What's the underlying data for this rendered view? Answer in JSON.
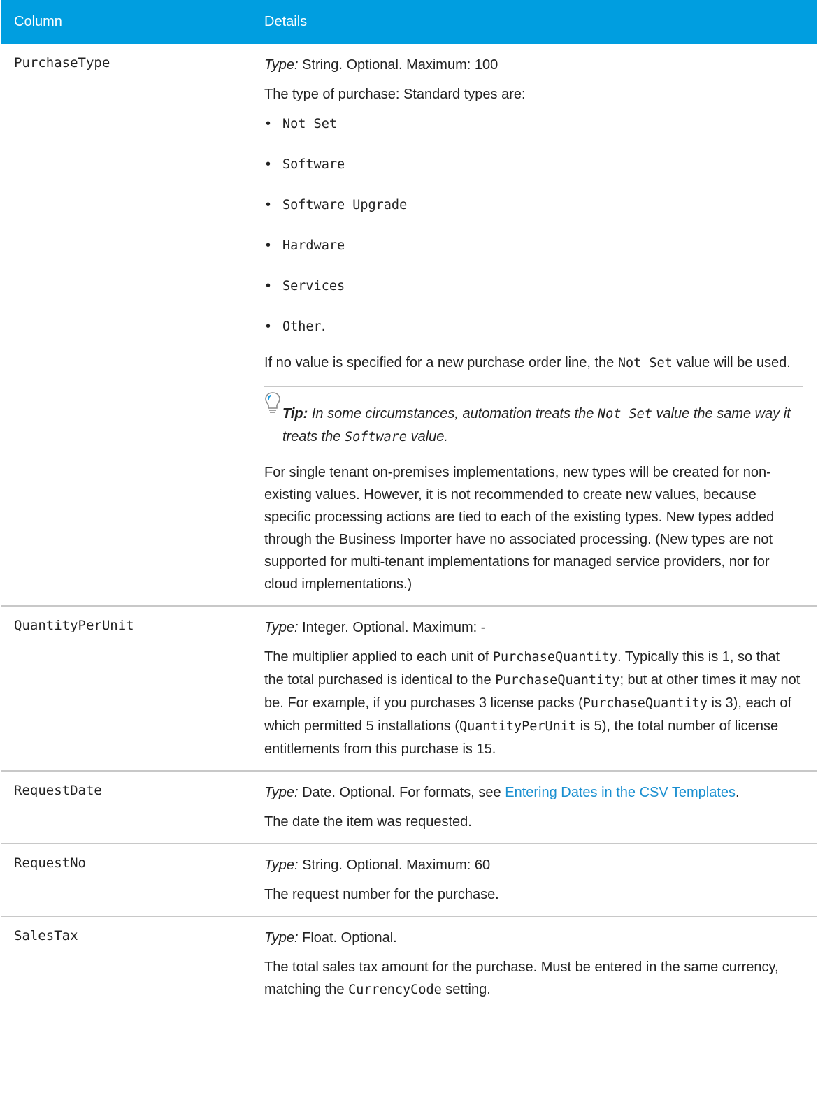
{
  "header": {
    "col1": "Column",
    "col2": "Details"
  },
  "type_label": "Type:",
  "rows": [
    {
      "name": "PurchaseType",
      "type_text": "String. Optional. Maximum: 100",
      "intro": "The type of purchase: Standard types are:",
      "items": [
        "Not Set",
        "Software",
        "Software Upgrade",
        "Hardware",
        "Services",
        "Other"
      ],
      "items_last_suffix": ".",
      "p2_a": "If no value is specified for a new purchase order line, the ",
      "p2_code": "Not Set",
      "p2_b": " value will be used.",
      "tip_label": "Tip:",
      "tip_a": " In some circumstances, automation treats the ",
      "tip_code1": "Not Set",
      "tip_b": " value the same way it treats the ",
      "tip_code2": "Software",
      "tip_c": " value.",
      "p3": "For single tenant on-premises implementations, new types will be created for non-existing values. However, it is not recommended to create new values, because specific processing actions are tied to each of the existing types. New types added through the Business Importer have no associated processing. (New types are not supported for multi-tenant implementations for managed service providers, nor for cloud implementations.)"
    },
    {
      "name": "QuantityPerUnit",
      "type_text": "Integer. Optional. Maximum: -",
      "d_a": "The multiplier applied to each unit of ",
      "d_code1": "PurchaseQuantity",
      "d_b": ". Typically this is 1, so that the total purchased is identical to the ",
      "d_code2": "PurchaseQuantity",
      "d_c": "; but at other times it may not be. For example, if you purchases 3 license packs (",
      "d_code3": "PurchaseQuantity",
      "d_d": " is 3), each of which permitted 5 installations (",
      "d_code4": "QuantityPerUnit",
      "d_e": " is 5), the total number of license entitlements from this purchase is 15."
    },
    {
      "name": "RequestDate",
      "type_text": "Date. Optional. For formats, see ",
      "link": "Entering Dates in the CSV Templates",
      "type_suffix": ".",
      "desc": "The date the item was requested."
    },
    {
      "name": "RequestNo",
      "type_text": "String. Optional. Maximum: 60",
      "desc": "The request number for the purchase."
    },
    {
      "name": "SalesTax",
      "type_text": "Float. Optional.",
      "d_a": "The total sales tax amount for the purchase. Must be entered in the same currency, matching the ",
      "d_code": "CurrencyCode",
      "d_b": " setting."
    }
  ]
}
